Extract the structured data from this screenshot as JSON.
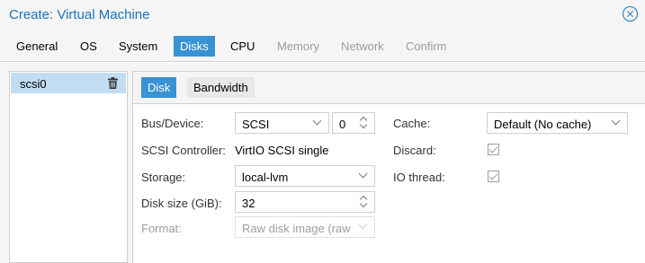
{
  "window": {
    "title": "Create: Virtual Machine"
  },
  "tabs": [
    {
      "label": "General",
      "state": "normal"
    },
    {
      "label": "OS",
      "state": "normal"
    },
    {
      "label": "System",
      "state": "normal"
    },
    {
      "label": "Disks",
      "state": "active"
    },
    {
      "label": "CPU",
      "state": "normal"
    },
    {
      "label": "Memory",
      "state": "disabled"
    },
    {
      "label": "Network",
      "state": "disabled"
    },
    {
      "label": "Confirm",
      "state": "disabled"
    }
  ],
  "disks": [
    {
      "label": "scsi0",
      "selected": true
    }
  ],
  "subtabs": [
    {
      "label": "Disk",
      "active": true
    },
    {
      "label": "Bandwidth",
      "active": false
    }
  ],
  "form": {
    "bus_label": "Bus/Device:",
    "bus_value": "SCSI",
    "device_index": "0",
    "controller_label": "SCSI Controller:",
    "controller_value": "VirtIO SCSI single",
    "storage_label": "Storage:",
    "storage_value": "local-lvm",
    "size_label": "Disk size (GiB):",
    "size_value": "32",
    "format_label": "Format:",
    "format_value": "Raw disk image (raw",
    "cache_label": "Cache:",
    "cache_value": "Default (No cache)",
    "discard_label": "Discard:",
    "discard_checked": true,
    "iothread_label": "IO thread:",
    "iothread_checked": true
  },
  "colors": {
    "accent": "#3892d4",
    "title": "#1a73bd",
    "selection": "#c2ddf2"
  }
}
